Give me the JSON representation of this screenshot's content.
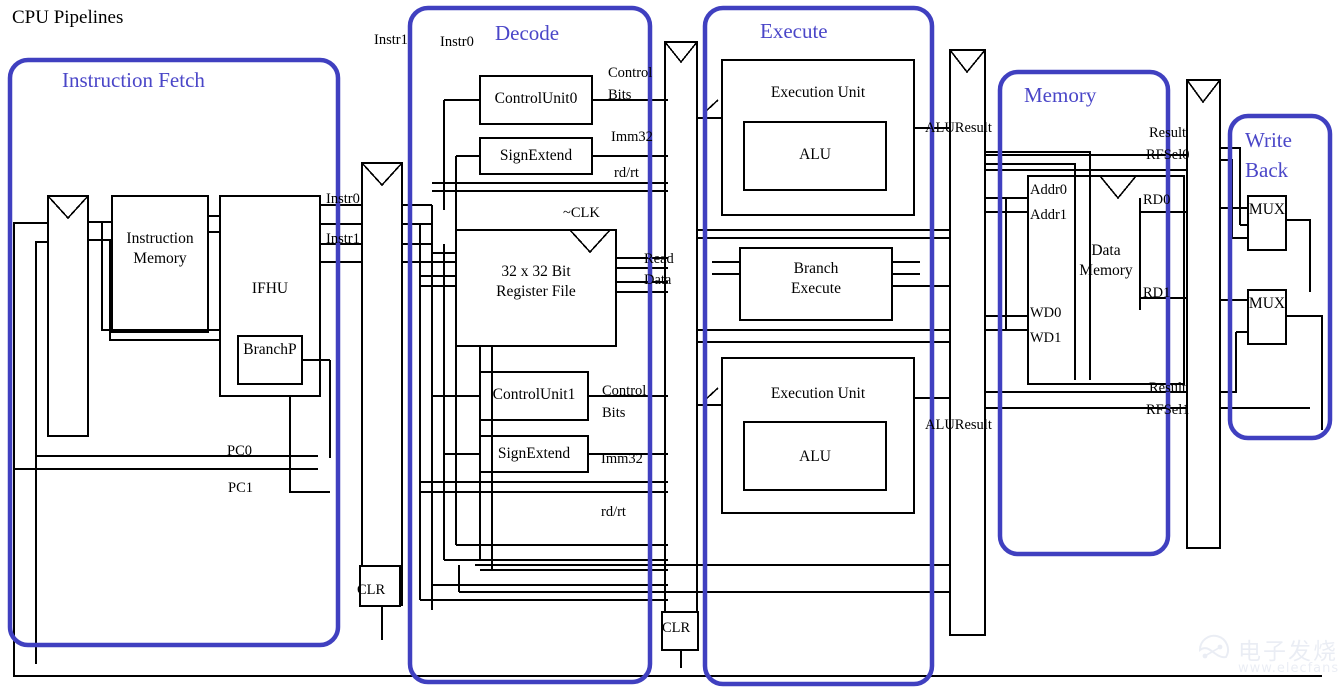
{
  "diagram": {
    "title": "CPU Pipelines",
    "accent_color": "#4040c0",
    "wire_color": "#000000",
    "background": "#ffffff"
  },
  "stages": [
    {
      "id": "instruction-fetch",
      "label": "Instruction Fetch"
    },
    {
      "id": "decode",
      "label": "Decode"
    },
    {
      "id": "execute",
      "label": "Execute"
    },
    {
      "id": "memory",
      "label": "Memory"
    },
    {
      "id": "write-back",
      "label": "Write\nBack",
      "line1": "Write",
      "line2": "Back"
    }
  ],
  "blocks": {
    "instruction_memory": {
      "line1": "Instruction",
      "line2": "Memory"
    },
    "ifhu": {
      "label": "IFHU"
    },
    "branch_predictor": {
      "label": "BranchP"
    },
    "control_unit_0": {
      "label": "ControlUnit0"
    },
    "control_unit_1": {
      "label": "ControlUnit1"
    },
    "sign_extend_0": {
      "label": "SignExtend"
    },
    "sign_extend_1": {
      "label": "SignExtend"
    },
    "register_file": {
      "line1": "32 x 32 Bit",
      "line2": "Register File"
    },
    "execution_unit_0": {
      "label": "Execution Unit"
    },
    "alu_0": {
      "label": "ALU"
    },
    "branch_execute": {
      "line1": "Branch",
      "line2": "Execute"
    },
    "execution_unit_1": {
      "label": "Execution Unit"
    },
    "alu_1": {
      "label": "ALU"
    },
    "data_memory": {
      "line1": "Data",
      "line2": "Memory"
    },
    "mux_0": {
      "label": "MUX"
    },
    "mux_1": {
      "label": "MUX"
    }
  },
  "signals": {
    "instr1_left": "Instr1",
    "instr0_decode": "Instr0",
    "instr0_reg": "Instr0",
    "instr1_reg": "Instr1",
    "pc0": "PC0",
    "pc1": "PC1",
    "clr_if": "CLR",
    "clr_id": "CLR",
    "control_bits_0_l1": "Control",
    "control_bits_0_l2": "Bits",
    "imm32_0": "Imm32",
    "rd_rt_0": "rd/rt",
    "clk": "~CLK",
    "read_data_l1": "Read",
    "read_data_l2": "Data",
    "control_bits_1_l1": "Control",
    "control_bits_1_l2": "Bits",
    "imm32_1": "Imm32",
    "rd_rt_1": "rd/rt",
    "alu_result_0": "ALUResult",
    "alu_result_1": "ALUResult",
    "addr0": "Addr0",
    "addr1": "Addr1",
    "wd0": "WD0",
    "wd1": "WD1",
    "result_0": "Result",
    "rf_sel_0": "RFSel0",
    "rd0": "RD0",
    "rd1": "RD1",
    "result_1": "Result",
    "rf_sel_1": "RFSel1"
  },
  "pipeline_registers": [
    {
      "id": "if-id-register",
      "clear_label": "CLR"
    },
    {
      "id": "id-ex-register",
      "clear_label": "CLR"
    },
    {
      "id": "ex-mem-register",
      "clear_label": ""
    },
    {
      "id": "mem-wb-register",
      "clear_label": ""
    }
  ],
  "watermark": {
    "text_cn": "电子发烧友",
    "url": "www.elecfans.com"
  }
}
